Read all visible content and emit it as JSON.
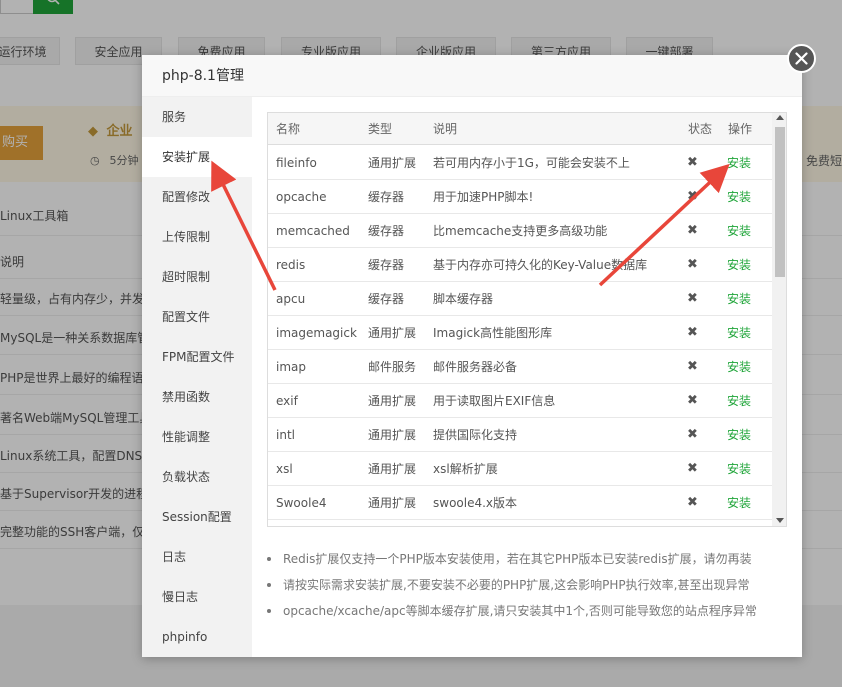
{
  "background": {
    "tabs": [
      "运行环境",
      "安全应用",
      "免费应用",
      "专业版应用",
      "企业版应用",
      "第三方应用",
      "一键部署"
    ],
    "buy_label": "购买",
    "enterprise_label": "企业",
    "enterprise_sub": "5分钟",
    "right_text": "免费短信",
    "rows": [
      "Linux工具箱",
      "说明",
      "轻量级，占有内存少，并发能",
      "MySQL是一种关系数据库管理",
      "PHP是世界上最好的编程语言",
      "著名Web端MySQL管理工具",
      "Linux系统工具，配置DNS、S",
      "基于Supervisor开发的进程守",
      "完整功能的SSH客户端，仅用"
    ]
  },
  "modal": {
    "title": "php-8.1管理",
    "close_icon": "close-icon"
  },
  "sidebar": {
    "items": [
      {
        "label": "服务"
      },
      {
        "label": "安装扩展"
      },
      {
        "label": "配置修改"
      },
      {
        "label": "上传限制"
      },
      {
        "label": "超时限制"
      },
      {
        "label": "配置文件"
      },
      {
        "label": "FPM配置文件"
      },
      {
        "label": "禁用函数"
      },
      {
        "label": "性能调整"
      },
      {
        "label": "负载状态"
      },
      {
        "label": "Session配置"
      },
      {
        "label": "日志"
      },
      {
        "label": "慢日志"
      },
      {
        "label": "phpinfo"
      }
    ],
    "active_index": 1
  },
  "table": {
    "headers": {
      "name": "名称",
      "type": "类型",
      "desc": "说明",
      "status": "状态",
      "op": "操作"
    },
    "rows": [
      {
        "name": "fileinfo",
        "type": "通用扩展",
        "desc": "若可用内存小于1G，可能会安装不上",
        "status": "✖",
        "op": "安装"
      },
      {
        "name": "opcache",
        "type": "缓存器",
        "desc": "用于加速PHP脚本!",
        "status": "✖",
        "op": "安装"
      },
      {
        "name": "memcached",
        "type": "缓存器",
        "desc": "比memcache支持更多高级功能",
        "status": "✖",
        "op": "安装"
      },
      {
        "name": "redis",
        "type": "缓存器",
        "desc": "基于内存亦可持久化的Key-Value数据库",
        "status": "✖",
        "op": "安装"
      },
      {
        "name": "apcu",
        "type": "缓存器",
        "desc": "脚本缓存器",
        "status": "✖",
        "op": "安装"
      },
      {
        "name": "imagemagick",
        "type": "通用扩展",
        "desc": "Imagick高性能图形库",
        "status": "✖",
        "op": "安装"
      },
      {
        "name": "imap",
        "type": "邮件服务",
        "desc": "邮件服务器必备",
        "status": "✖",
        "op": "安装"
      },
      {
        "name": "exif",
        "type": "通用扩展",
        "desc": "用于读取图片EXIF信息",
        "status": "✖",
        "op": "安装"
      },
      {
        "name": "intl",
        "type": "通用扩展",
        "desc": "提供国际化支持",
        "status": "✖",
        "op": "安装"
      },
      {
        "name": "xsl",
        "type": "通用扩展",
        "desc": "xsl解析扩展",
        "status": "✖",
        "op": "安装"
      },
      {
        "name": "Swoole4",
        "type": "通用扩展",
        "desc": "swoole4.x版本",
        "status": "✖",
        "op": "安装"
      }
    ]
  },
  "notes": [
    "Redis扩展仅支持一个PHP版本安装使用，若在其它PHP版本已安装redis扩展，请勿再装",
    "请按实际需求安装扩展,不要安装不必要的PHP扩展,这会影响PHP执行效率,甚至出现异常",
    "opcache/xcache/apc等脚本缓存扩展,请只安装其中1个,否则可能导致您的站点程序异常"
  ],
  "colors": {
    "accent_green": "#20a53a",
    "annotation_red": "#e8463a"
  }
}
